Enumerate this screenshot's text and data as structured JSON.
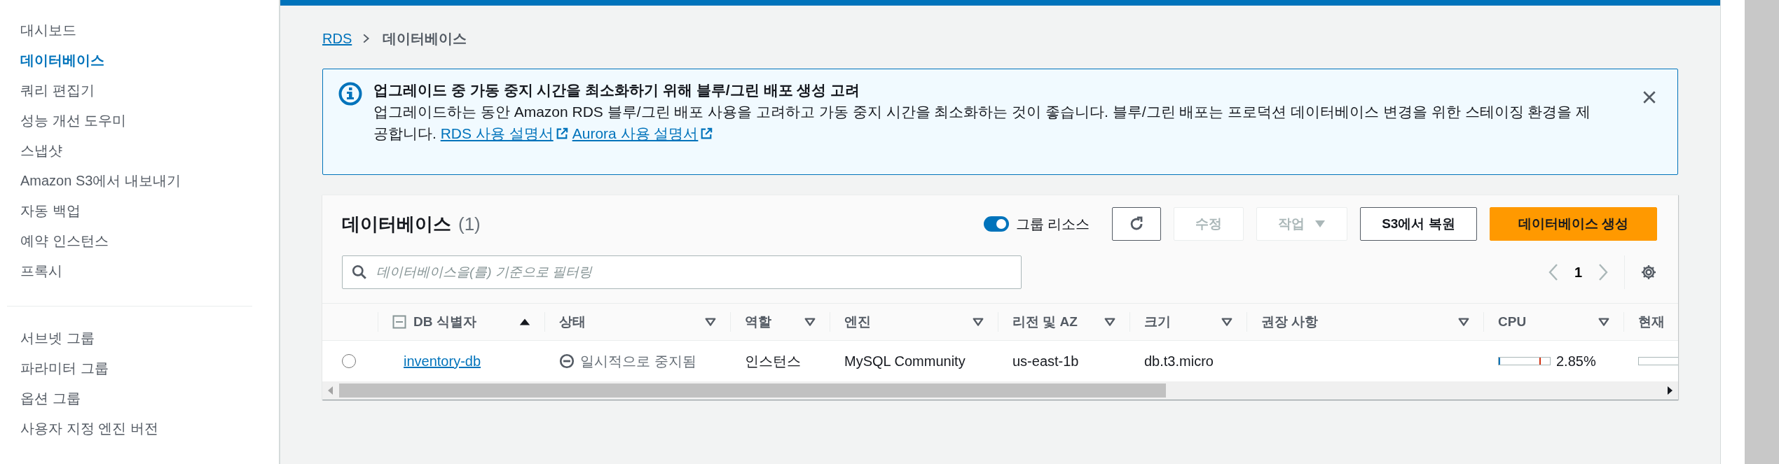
{
  "sidebar": {
    "sections": [
      {
        "items": [
          {
            "label": "대시보드",
            "selected": false
          },
          {
            "label": "데이터베이스",
            "selected": true
          },
          {
            "label": "쿼리 편집기",
            "selected": false
          },
          {
            "label": "성능 개선 도우미",
            "selected": false
          },
          {
            "label": "스냅샷",
            "selected": false
          },
          {
            "label": "Amazon S3에서 내보내기",
            "selected": false
          },
          {
            "label": "자동 백업",
            "selected": false
          },
          {
            "label": "예약 인스턴스",
            "selected": false
          },
          {
            "label": "프록시",
            "selected": false
          }
        ]
      },
      {
        "items": [
          {
            "label": "서브넷 그룹",
            "selected": false
          },
          {
            "label": "파라미터 그룹",
            "selected": false
          },
          {
            "label": "옵션 그룹",
            "selected": false
          },
          {
            "label": "사용자 지정 엔진 버전",
            "selected": false
          }
        ]
      }
    ]
  },
  "breadcrumb": [
    {
      "label": "RDS",
      "kind": "link"
    },
    {
      "label": "데이터베이스",
      "kind": "current"
    }
  ],
  "alert": {
    "title": "업그레이드 중 가동 중지 시간을 최소화하기 위해 블루/그린 배포 생성 고려",
    "body": "업그레이드하는 동안 Amazon RDS 블루/그린 배포 사용을 고려하고 가동 중지 시간을 최소화하는 것이 좋습니다. 블루/그린 배포는 프로덕션 데이터베이스 변경을 위한 스테이징 환경을 제공합니다.",
    "links": [
      "RDS 사용 설명서",
      "Aurora 사용 설명서"
    ]
  },
  "panel": {
    "title": "데이터베이스",
    "count": "(1)",
    "group_resources": {
      "label": "그룹 리소스",
      "on": true
    },
    "buttons": [
      {
        "kind": "refresh",
        "disabled": false
      },
      {
        "kind": "normal",
        "label": "수정",
        "disabled": true
      },
      {
        "kind": "dropdown",
        "label": "작업",
        "disabled": true
      },
      {
        "kind": "normal",
        "label": "S3에서 복원",
        "disabled": false
      },
      {
        "kind": "primary",
        "label": "데이터베이스 생성",
        "disabled": false
      }
    ],
    "filter": {
      "placeholder": "데이터베이스을(를) 기준으로 필터링"
    },
    "pagination": {
      "page": "1",
      "prev_disabled": true,
      "next_disabled": true
    }
  },
  "table": {
    "columns": [
      {
        "label": "DB 식별자",
        "sorted": true
      },
      {
        "label": "상태",
        "sorted": false
      },
      {
        "label": "역할",
        "sorted": false
      },
      {
        "label": "엔진",
        "sorted": false
      },
      {
        "label": "리전 및 AZ",
        "sorted": false
      },
      {
        "label": "크기",
        "sorted": false
      },
      {
        "label": "권장 사항",
        "sorted": false
      },
      {
        "label": "CPU",
        "sorted": false
      },
      {
        "label": "현재"
      }
    ],
    "rows": [
      {
        "selected": false,
        "identifier": "inventory-db",
        "status": "일시적으로 중지됨",
        "role": "인스턴스",
        "engine": "MySQL Community",
        "region": "us-east-1b",
        "size": "db.t3.micro",
        "cpu": {
          "level": 0.0285,
          "reading": "2.85%"
        }
      }
    ]
  }
}
